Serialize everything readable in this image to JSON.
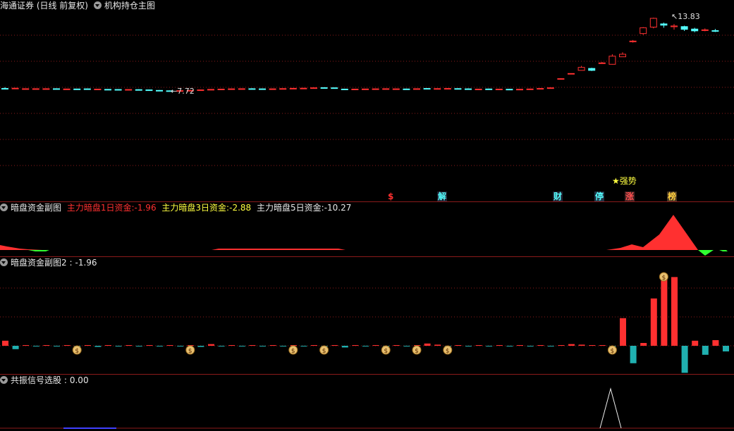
{
  "main": {
    "title": "海通证券 (日线 前复权)",
    "indicator": "机构持仓主图",
    "high_label": "13.83",
    "low_label": "7.72",
    "signal_text": "强势",
    "markers": [
      "$",
      "解",
      "财",
      "停",
      "涨",
      "榜"
    ]
  },
  "pane2": {
    "title": "暗盘资金副图",
    "items": [
      {
        "label": "主力暗盘1日资金:",
        "value": "-1.96",
        "color": "#ff3030"
      },
      {
        "label": "主力暗盘3日资金:",
        "value": "-2.88",
        "color": "#ffff40"
      },
      {
        "label": "主力暗盘5日资金:",
        "value": "-10.27",
        "color": "#e8e8e8"
      }
    ]
  },
  "pane3": {
    "title": "暗盘资金副图2 :",
    "value": "-1.96"
  },
  "pane4": {
    "title": "共振信号选股 :",
    "value": "0.00"
  },
  "colors": {
    "up": "#ff3030",
    "down": "#54ffff",
    "grid": "#8b1a1a",
    "bg": "#000000"
  },
  "chart_data": {
    "type": "candlestick",
    "candles": [
      [
        7.95,
        8.05,
        7.88,
        7.92
      ],
      [
        7.95,
        7.99,
        7.9,
        7.97
      ],
      [
        7.92,
        7.95,
        7.89,
        7.93
      ],
      [
        7.92,
        7.95,
        7.89,
        7.93
      ],
      [
        7.9,
        7.96,
        7.88,
        7.93
      ],
      [
        7.93,
        7.96,
        7.89,
        7.91
      ],
      [
        7.89,
        7.93,
        7.86,
        7.91
      ],
      [
        7.91,
        7.93,
        7.87,
        7.89
      ],
      [
        7.92,
        7.95,
        7.87,
        7.88
      ],
      [
        7.88,
        7.92,
        7.85,
        7.9
      ],
      [
        7.88,
        7.91,
        7.84,
        7.87
      ],
      [
        7.87,
        7.9,
        7.83,
        7.86
      ],
      [
        7.85,
        7.89,
        7.82,
        7.87
      ],
      [
        7.86,
        7.89,
        7.82,
        7.84
      ],
      [
        7.84,
        7.87,
        7.79,
        7.8
      ],
      [
        7.8,
        7.83,
        7.77,
        7.78
      ],
      [
        7.77,
        7.8,
        7.72,
        7.76
      ],
      [
        7.76,
        7.79,
        7.74,
        7.78
      ],
      [
        7.78,
        7.81,
        7.76,
        7.8
      ],
      [
        7.8,
        7.85,
        7.78,
        7.84
      ],
      [
        7.85,
        7.89,
        7.82,
        7.88
      ],
      [
        7.88,
        7.92,
        7.85,
        7.9
      ],
      [
        7.9,
        7.94,
        7.88,
        7.92
      ],
      [
        7.92,
        7.95,
        7.89,
        7.93
      ],
      [
        7.93,
        7.97,
        7.9,
        7.92
      ],
      [
        7.92,
        7.95,
        7.88,
        7.9
      ],
      [
        7.9,
        7.94,
        7.87,
        7.92
      ],
      [
        7.92,
        7.96,
        7.9,
        7.94
      ],
      [
        7.94,
        7.98,
        7.91,
        7.96
      ],
      [
        7.95,
        7.99,
        7.92,
        7.97
      ],
      [
        7.96,
        8.02,
        7.94,
        8.0
      ],
      [
        8.01,
        8.04,
        7.97,
        7.99
      ],
      [
        8.0,
        8.02,
        7.94,
        7.95
      ],
      [
        7.9,
        7.93,
        7.86,
        7.88
      ],
      [
        7.88,
        7.92,
        7.86,
        7.9
      ],
      [
        7.9,
        7.93,
        7.88,
        7.91
      ],
      [
        7.91,
        7.94,
        7.88,
        7.92
      ],
      [
        7.92,
        7.95,
        7.89,
        7.93
      ],
      [
        7.91,
        7.94,
        7.89,
        7.92
      ],
      [
        7.91,
        7.94,
        7.88,
        7.9
      ],
      [
        7.9,
        7.94,
        7.88,
        7.93
      ],
      [
        7.95,
        7.98,
        7.91,
        7.93
      ],
      [
        7.93,
        7.96,
        7.9,
        7.94
      ],
      [
        7.94,
        7.97,
        7.91,
        7.95
      ],
      [
        7.94,
        7.97,
        7.91,
        7.93
      ],
      [
        7.92,
        7.96,
        7.89,
        7.91
      ],
      [
        7.89,
        7.93,
        7.86,
        7.9
      ],
      [
        7.91,
        7.94,
        7.87,
        7.88
      ],
      [
        7.88,
        7.92,
        7.86,
        7.9
      ],
      [
        7.89,
        7.92,
        7.86,
        7.88
      ],
      [
        7.88,
        7.91,
        7.85,
        7.89
      ],
      [
        7.89,
        7.93,
        7.87,
        7.91
      ],
      [
        7.91,
        7.96,
        7.89,
        7.95
      ],
      [
        7.99,
        8.02,
        7.94,
        8.0
      ],
      [
        8.7,
        8.73,
        8.68,
        8.71
      ],
      [
        9.1,
        9.13,
        9.08,
        9.11
      ],
      [
        9.35,
        9.7,
        9.35,
        9.58
      ],
      [
        9.5,
        9.55,
        9.3,
        9.35
      ],
      [
        9.9,
        10.0,
        9.86,
        9.93
      ],
      [
        9.82,
        10.6,
        9.8,
        10.45
      ],
      [
        10.4,
        10.75,
        10.4,
        10.6
      ],
      [
        11.58,
        11.7,
        11.5,
        11.62
      ],
      [
        12.2,
        12.7,
        12.1,
        12.65
      ],
      [
        12.7,
        13.43,
        12.6,
        13.38
      ],
      [
        12.95,
        13.05,
        12.65,
        12.85
      ],
      [
        12.73,
        12.94,
        12.5,
        12.79
      ],
      [
        12.74,
        12.81,
        12.4,
        12.53
      ],
      [
        12.55,
        12.65,
        12.3,
        12.41
      ],
      [
        12.48,
        12.6,
        12.38,
        12.49
      ],
      [
        12.43,
        12.56,
        12.32,
        12.4
      ]
    ],
    "pane3_bars": [
      0.9,
      -0.6,
      0.1,
      -0.1,
      0.1,
      -0.1,
      0.1,
      -0.1,
      0.1,
      -0.2,
      0.1,
      -0.1,
      0.1,
      -0.1,
      0.1,
      -0.1,
      0.1,
      -0.1,
      0.1,
      -0.2,
      0.3,
      -0.1,
      0.1,
      -0.1,
      0.1,
      -0.1,
      0.1,
      -0.1,
      0.1,
      -0.1,
      0.1,
      -0.1,
      0.1,
      -0.3,
      0.1,
      -0.1,
      0.1,
      -0.1,
      0.1,
      -0.1,
      0.1,
      0.4,
      0.2,
      -0.1,
      0.1,
      -0.1,
      0.1,
      -0.1,
      0.1,
      -0.1,
      0.1,
      -0.1,
      0.1,
      -0.1,
      0.1,
      0.3,
      0.2,
      0.1,
      0.1,
      -0.1,
      4.9,
      -3.1,
      0.5,
      8.4,
      12.8,
      12.2,
      -4.8,
      0.9,
      -1.6,
      1.0,
      -1.0
    ]
  }
}
